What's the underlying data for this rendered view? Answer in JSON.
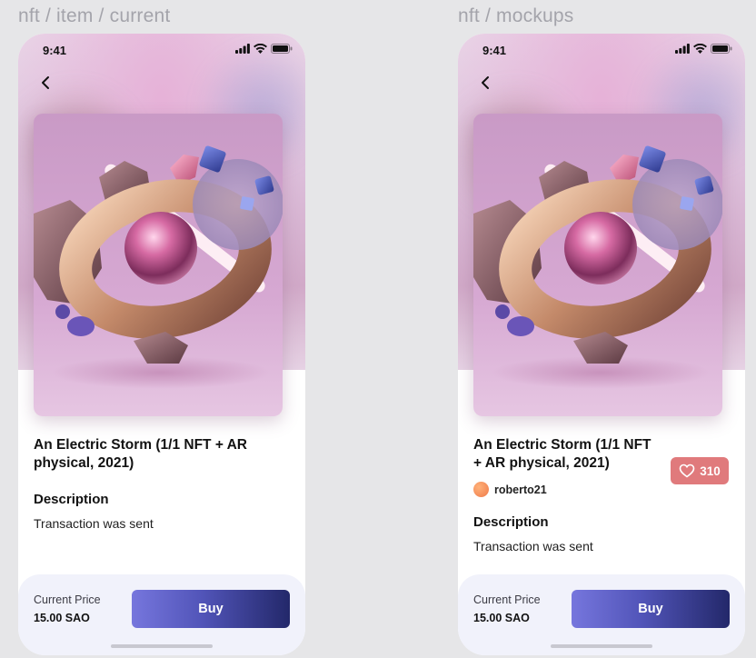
{
  "frames": [
    {
      "label": "nft / item / current",
      "status_time": "9:41",
      "title": "An Electric Storm (1/1 NFT + AR physical, 2021)",
      "description_heading": "Description",
      "description_text": "Transaction was sent",
      "price_label": "Current Price",
      "price_value": "15.00 SAO",
      "buy_label": "Buy"
    },
    {
      "label": "nft / mockups",
      "status_time": "9:41",
      "title": "An Electric Storm (1/1 NFT + AR physical, 2021)",
      "owner_name": "roberto21",
      "likes": "310",
      "description_heading": "Description",
      "description_text": "Transaction was sent",
      "price_label": "Current Price",
      "price_value": "15.00 SAO",
      "buy_label": "Buy"
    }
  ],
  "colors": {
    "background": "#e6e6e8",
    "like_button": "#e07a7c",
    "buy_gradient_start": "#7676dd",
    "buy_gradient_end": "#23286a",
    "bottom_panel": "#f1f2fb"
  },
  "icons": [
    "chevron-left-icon",
    "signal-icon",
    "wifi-icon",
    "battery-icon",
    "heart-icon"
  ]
}
